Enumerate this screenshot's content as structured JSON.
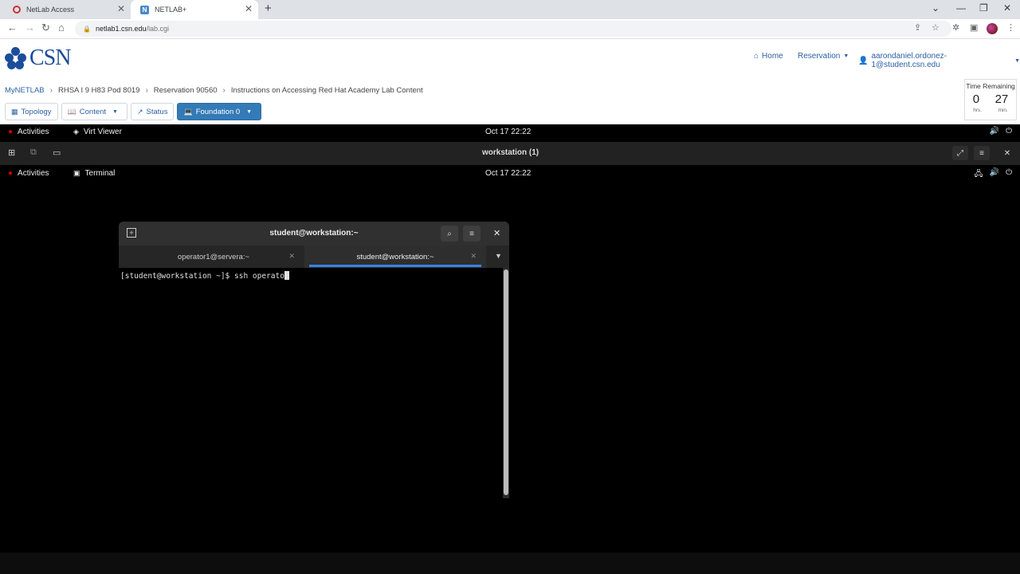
{
  "browser": {
    "tabs": [
      {
        "title": "NetLab Access"
      },
      {
        "title": "NETLAB+"
      }
    ],
    "url_host": "netlab1.csn.edu",
    "url_path": "/lab.cgi"
  },
  "site": {
    "logo_text": "CSN",
    "nav": {
      "home": "Home",
      "reservation": "Reservation",
      "user": "aarondaniel.ordonez-1@student.csn.edu"
    },
    "breadcrumb": [
      "MyNETLAB",
      "RHSA I 9 H83 Pod 8019",
      "Reservation 90560",
      "Instructions on Accessing Red Hat Academy Lab Content"
    ],
    "pills": {
      "topology": "Topology",
      "content": "Content",
      "status": "Status",
      "foundation": "Foundation 0"
    },
    "timer": {
      "label": "Time Remaining",
      "hours": "0",
      "minutes": "27",
      "hours_unit": "hrs.",
      "minutes_unit": "min."
    }
  },
  "outer_desktop": {
    "activities": "Activities",
    "app": "Virt Viewer",
    "clock": "Oct 17  22:22"
  },
  "virt_viewer": {
    "title": "workstation (1)"
  },
  "inner_desktop": {
    "activities": "Activities",
    "app": "Terminal",
    "clock": "Oct 17  22:22"
  },
  "terminal": {
    "title": "student@workstation:~",
    "tabs": [
      {
        "title": "operator1@servera:~",
        "active": false
      },
      {
        "title": "student@workstation:~",
        "active": true
      }
    ],
    "prompt": "[student@workstation ~]$ ",
    "command": "ssh operato"
  },
  "colors": {
    "link": "#2b5fa6",
    "primary_button": "#337ab7",
    "tab_indicator": "#3584e4",
    "redhat": "#cc0000"
  }
}
